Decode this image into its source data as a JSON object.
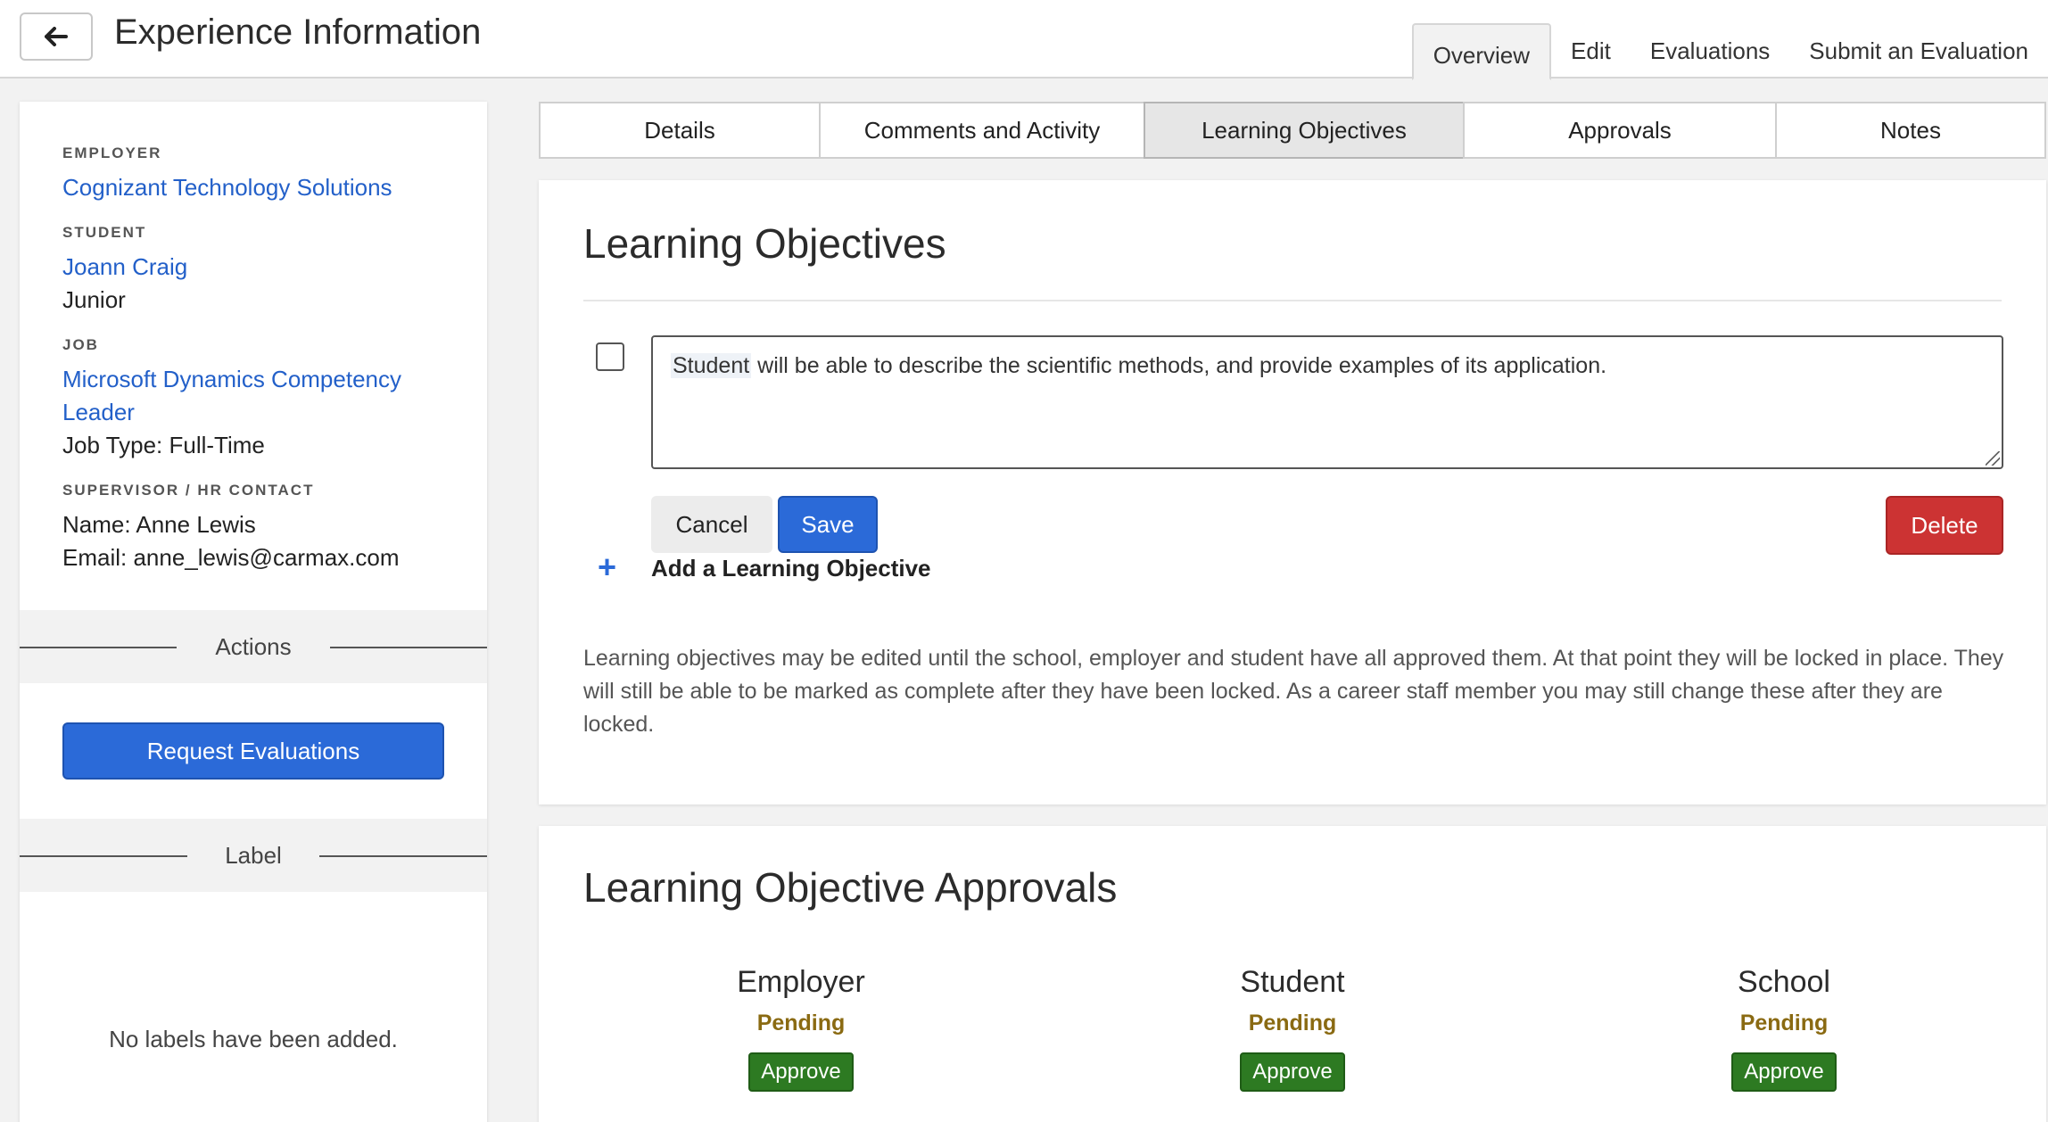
{
  "header": {
    "back_icon": "arrow-left-icon",
    "title": "Experience Information",
    "tabs": [
      {
        "label": "Overview",
        "active": true
      },
      {
        "label": "Edit",
        "active": false
      },
      {
        "label": "Evaluations",
        "active": false
      },
      {
        "label": "Submit an Evaluation",
        "active": false
      }
    ]
  },
  "sidebar": {
    "employer_label": "EMPLOYER",
    "employer_name": "Cognizant Technology Solutions",
    "student_label": "STUDENT",
    "student_name": "Joann Craig",
    "student_year": "Junior",
    "job_label": "JOB",
    "job_title_line1": "Microsoft Dynamics Competency",
    "job_title_line2": "Leader",
    "job_type": "Job Type: Full-Time",
    "supervisor_label": "SUPERVISOR / HR CONTACT",
    "supervisor_name": "Name: Anne Lewis",
    "supervisor_email": "Email: anne_lewis@carmax.com",
    "actions_heading": "Actions",
    "request_button": "Request Evaluations",
    "label_heading": "Label",
    "no_labels": "No labels have been added."
  },
  "main_tabs": [
    {
      "label": "Details",
      "active": false
    },
    {
      "label": "Comments and Activity",
      "active": false
    },
    {
      "label": "Learning Objectives",
      "active": true
    },
    {
      "label": "Approvals",
      "active": false
    },
    {
      "label": "Notes",
      "active": false
    }
  ],
  "learning_objectives": {
    "title": "Learning Objectives",
    "objective_highlight": "Student",
    "objective_rest": " will be able to describe the scientific methods, and provide examples of its application.",
    "cancel_label": "Cancel",
    "save_label": "Save",
    "delete_label": "Delete",
    "add_label": "Add a Learning Objective",
    "help_text": "Learning objectives may be edited until the school, employer and student have all approved them. At that point they will be locked in place. They will still be able to be marked as complete after they have been locked. As a career staff member you may still change these after they are locked."
  },
  "approvals": {
    "title": "Learning Objective Approvals",
    "columns": [
      {
        "name": "Employer",
        "status": "Pending",
        "button": "Approve"
      },
      {
        "name": "Student",
        "status": "Pending",
        "button": "Approve"
      },
      {
        "name": "School",
        "status": "Pending",
        "button": "Approve"
      }
    ]
  },
  "colors": {
    "primary": "#2b6ad8",
    "link": "#2360c9",
    "danger": "#cc3333",
    "approve": "#2d7a22",
    "pending": "#8a6a12"
  }
}
